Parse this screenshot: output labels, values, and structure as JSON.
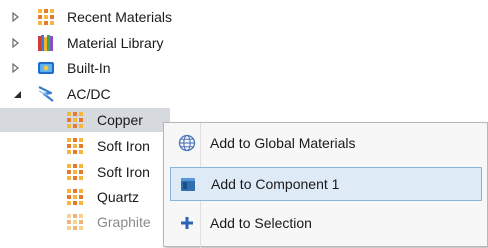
{
  "tree": {
    "items": [
      {
        "label": "Recent Materials",
        "icon": "material-grid-icon",
        "expanded": false
      },
      {
        "label": "Material Library",
        "icon": "library-books-icon",
        "expanded": false
      },
      {
        "label": "Built-In",
        "icon": "built-in-folder-icon",
        "expanded": false
      },
      {
        "label": "AC/DC",
        "icon": "acdc-lightning-icon",
        "expanded": true,
        "children": [
          {
            "label": "Copper",
            "selected": true
          },
          {
            "label": "Soft Iron"
          },
          {
            "label": "Soft Iron"
          },
          {
            "label": "Quartz"
          },
          {
            "label": "Graphite"
          }
        ]
      }
    ]
  },
  "context_menu": {
    "items": [
      {
        "label": "Add to Global Materials",
        "icon": "globe-icon"
      },
      {
        "label": "Add to Component 1",
        "icon": "component-box-icon",
        "hovered": true
      },
      {
        "label": "Add to Selection",
        "icon": "plus-icon"
      }
    ]
  },
  "colors": {
    "selection_bg": "#d6d9dd",
    "menu_hover_bg": "#dfeaf7",
    "menu_hover_border": "#8ab3e0",
    "material_orange": "#f29a1f"
  }
}
